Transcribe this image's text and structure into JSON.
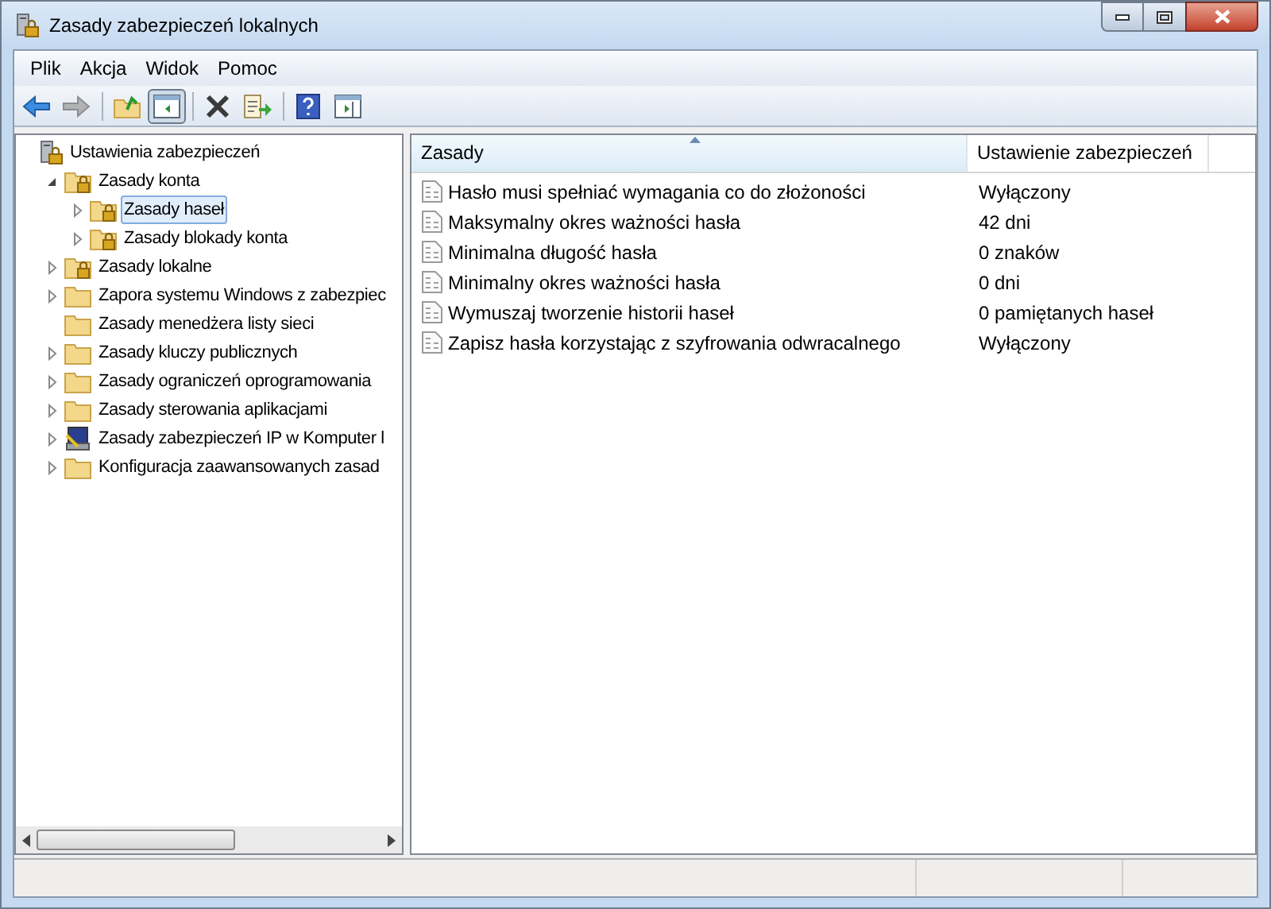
{
  "window": {
    "title": "Zasady zabezpieczeń lokalnych"
  },
  "menu": [
    {
      "label": "Plik"
    },
    {
      "label": "Akcja"
    },
    {
      "label": "Widok"
    },
    {
      "label": "Pomoc"
    }
  ],
  "toolbar": [
    {
      "kind": "back",
      "disabled": false,
      "pressed": false
    },
    {
      "kind": "forward",
      "disabled": true,
      "pressed": false
    },
    {
      "kind": "up",
      "disabled": false,
      "pressed": false
    },
    {
      "kind": "tree",
      "disabled": false,
      "pressed": true
    },
    {
      "kind": "delete",
      "disabled": false,
      "pressed": false
    },
    {
      "kind": "export",
      "disabled": false,
      "pressed": false
    },
    {
      "kind": "help",
      "disabled": false,
      "pressed": false
    },
    {
      "kind": "pane",
      "disabled": false,
      "pressed": false
    }
  ],
  "tree": [
    {
      "label": "Ustawienia zabezpieczeń",
      "kind": "root",
      "selected": false,
      "children": [
        {
          "label": "Zasady konta",
          "kind": "lockfolder",
          "expanded": true,
          "selected": false,
          "children": [
            {
              "label": "Zasady haseł",
              "kind": "lockfolder",
              "expanded": false,
              "selected": true
            },
            {
              "label": "Zasady blokady konta",
              "kind": "lockfolder",
              "expanded": false,
              "selected": false
            }
          ]
        },
        {
          "label": "Zasady lokalne",
          "kind": "lockfolder",
          "expanded": false,
          "selected": false
        },
        {
          "label": "Zapora systemu Windows z zabezpiec",
          "kind": "folder",
          "expanded": false,
          "selected": false
        },
        {
          "label": "Zasady menedżera listy sieci",
          "kind": "folder",
          "selected": false
        },
        {
          "label": "Zasady kluczy publicznych",
          "kind": "folder",
          "expanded": false,
          "selected": false
        },
        {
          "label": "Zasady ograniczeń oprogramowania",
          "kind": "folder",
          "expanded": false,
          "selected": false
        },
        {
          "label": "Zasady sterowania aplikacjami",
          "kind": "folder",
          "expanded": false,
          "selected": false
        },
        {
          "label": "Zasady zabezpieczeń IP w Komputer l",
          "kind": "computer",
          "expanded": false,
          "selected": false
        },
        {
          "label": "Konfiguracja zaawansowanych zasad",
          "kind": "folder",
          "expanded": false,
          "selected": false
        }
      ]
    }
  ],
  "table": {
    "columns": [
      {
        "label": "Zasady",
        "sorted": true
      },
      {
        "label": "Ustawienie zabezpieczeń",
        "sorted": false
      }
    ],
    "rows": [
      {
        "policy": "Hasło musi spełniać wymagania co do złożoności",
        "setting": "Wyłączony"
      },
      {
        "policy": "Maksymalny okres ważności hasła",
        "setting": "42 dni"
      },
      {
        "policy": "Minimalna długość hasła",
        "setting": "0 znaków"
      },
      {
        "policy": "Minimalny okres ważności hasła",
        "setting": "0 dni"
      },
      {
        "policy": "Wymuszaj tworzenie historii haseł",
        "setting": "0 pamiętanych haseł"
      },
      {
        "policy": "Zapisz hasła korzystając z szyfrowania odwracalnego",
        "setting": "Wyłączony"
      }
    ]
  }
}
